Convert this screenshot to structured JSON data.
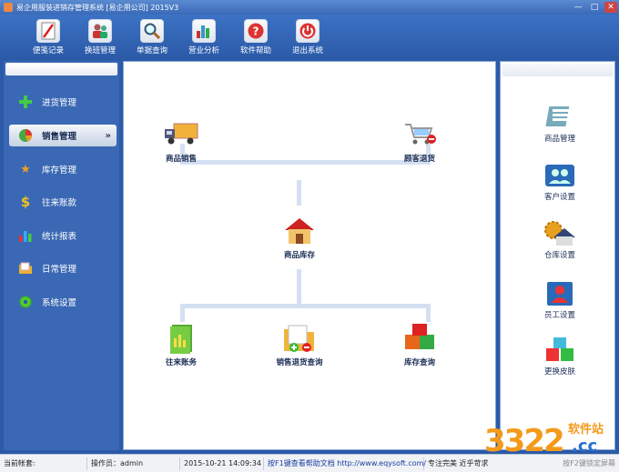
{
  "window": {
    "title": "易企用服装进销存管理系统 [易企用公司] 2015V3",
    "controls": [
      "—",
      "□",
      "✕"
    ]
  },
  "toolbar": [
    {
      "label": "便笺记录",
      "icon": "notepad-icon"
    },
    {
      "label": "换班管理",
      "icon": "users-icon"
    },
    {
      "label": "单据查询",
      "icon": "magnifier-icon"
    },
    {
      "label": "营业分析",
      "icon": "bar-chart-icon"
    },
    {
      "label": "软件帮助",
      "icon": "help-icon"
    },
    {
      "label": "退出系统",
      "icon": "power-icon"
    }
  ],
  "sidebar": {
    "items": [
      {
        "label": "进货管理",
        "icon": "plus-icon",
        "selected": false
      },
      {
        "label": "销售管理",
        "icon": "pie-chart-icon",
        "selected": true,
        "chevron": "»"
      },
      {
        "label": "库存管理",
        "icon": "star-icon",
        "selected": false
      },
      {
        "label": "往来账款",
        "icon": "dollar-icon",
        "selected": false
      },
      {
        "label": "统计报表",
        "icon": "bar-chart-icon",
        "selected": false
      },
      {
        "label": "日常管理",
        "icon": "folder-icon",
        "selected": false
      },
      {
        "label": "系统设置",
        "icon": "gear-icon",
        "selected": false
      }
    ]
  },
  "center": {
    "nodes": [
      {
        "label": "商品销售",
        "icon": "truck-icon"
      },
      {
        "label": "顾客退货",
        "icon": "cart-return-icon"
      },
      {
        "label": "商品库存",
        "icon": "house-icon"
      },
      {
        "label": "往来账务",
        "icon": "ledger-icon"
      },
      {
        "label": "销售退货查询",
        "icon": "folder-query-icon"
      },
      {
        "label": "库存查询",
        "icon": "boxes-icon"
      }
    ]
  },
  "right": {
    "items": [
      {
        "label": "商品管理",
        "icon": "catalog-icon"
      },
      {
        "label": "客户设置",
        "icon": "customers-icon"
      },
      {
        "label": "仓库设置",
        "icon": "warehouse-icon"
      },
      {
        "label": "员工设置",
        "icon": "staff-icon"
      },
      {
        "label": "更换皮肤",
        "icon": "cubes-icon"
      }
    ]
  },
  "status": {
    "account": "当前帐套:",
    "operator": "操作员：admin",
    "datetime": "2015-10-21 14:09:34",
    "help": "按F1键查看帮助文档 http://www.eqysoft.com/",
    "slogan": "专注完美 近乎苛求",
    "corner": "按F2键锁定屏幕"
  },
  "watermark": {
    "number": "3322",
    "cn": "软件站",
    "cc": ".cc"
  },
  "colors": {
    "frame": "#2a5aa8",
    "accent": "#f49a1a"
  }
}
